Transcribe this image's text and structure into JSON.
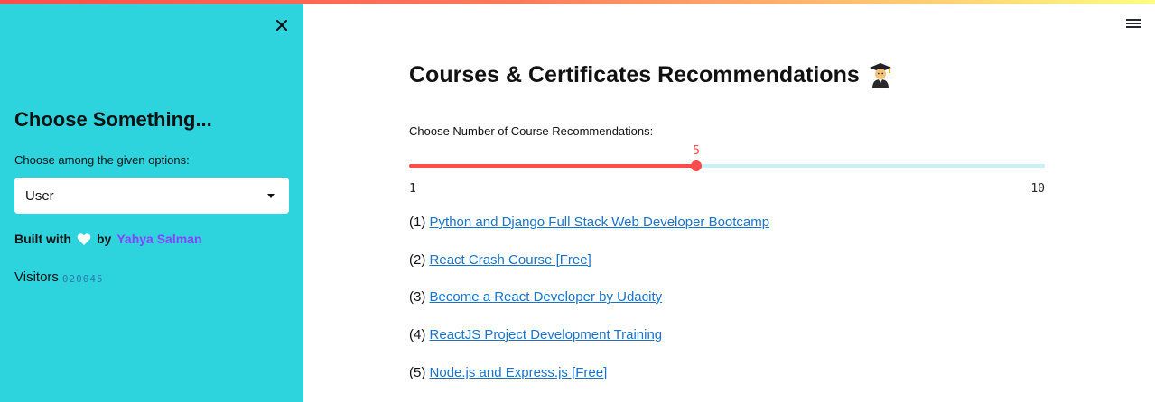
{
  "sidebar": {
    "title": "Choose Something...",
    "select_label": "Choose among the given options:",
    "select_value": "User",
    "built_with": "Built with",
    "by": "by",
    "author": "Yahya Salman",
    "visitors_label": "Visitors",
    "visitors_count": "020045"
  },
  "main": {
    "title": "Courses & Certificates Recommendations",
    "slider": {
      "label": "Choose Number of Course Recommendations:",
      "min": 1,
      "max": 10,
      "value": 5,
      "min_label": "1",
      "max_label": "10",
      "value_label": "5"
    },
    "courses": [
      {
        "index": "(1)",
        "title": "Python and Django Full Stack Web Developer Bootcamp"
      },
      {
        "index": "(2)",
        "title": "React Crash Course [Free]"
      },
      {
        "index": "(3)",
        "title": "Become a React Developer by Udacity"
      },
      {
        "index": "(4)",
        "title": "ReactJS Project Development Training"
      },
      {
        "index": "(5)",
        "title": "Node.js and Express.js [Free]"
      }
    ]
  },
  "colors": {
    "sidebar_bg": "#2dd4de",
    "accent": "#ff4b4b",
    "link": "#1a73c8",
    "author": "#8a3fff"
  },
  "icons": {
    "close": "close-icon",
    "menu": "hamburger-menu-icon",
    "heart": "heart-icon",
    "graduate": "graduate-emoji-icon",
    "caret": "chevron-down-icon"
  }
}
